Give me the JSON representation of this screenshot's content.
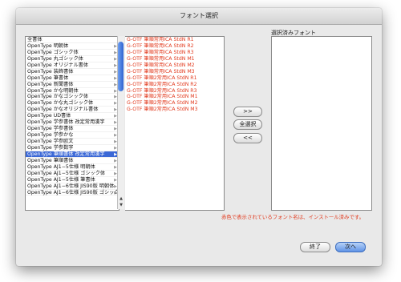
{
  "window": {
    "title": "フォント選択"
  },
  "font_categories": [
    {
      "label": "全書体",
      "selected": false
    },
    {
      "label": "OpenType 明朝体",
      "selected": false
    },
    {
      "label": "OpenType ゴシック体",
      "selected": false
    },
    {
      "label": "OpenType 丸ゴシック体",
      "selected": false
    },
    {
      "label": "OpenType オリジナル書体",
      "selected": false
    },
    {
      "label": "OpenType 装飾書体",
      "selected": false
    },
    {
      "label": "OpenType 筆書体",
      "selected": false
    },
    {
      "label": "OpenType 新聞書体",
      "selected": false
    },
    {
      "label": "OpenType かな明朝体",
      "selected": false
    },
    {
      "label": "OpenType かなゴシック体",
      "selected": false
    },
    {
      "label": "OpenType かな丸ゴシック体",
      "selected": false
    },
    {
      "label": "OpenType かなオリジナル書体",
      "selected": false
    },
    {
      "label": "OpenType UD書体",
      "selected": false
    },
    {
      "label": "OpenType 学参書体 改定常用漢字",
      "selected": false
    },
    {
      "label": "OpenType 学参書体",
      "selected": false
    },
    {
      "label": "OpenType 学参かな",
      "selected": false
    },
    {
      "label": "OpenType 学参欧文",
      "selected": false
    },
    {
      "label": "OpenType 学参数字",
      "selected": false
    },
    {
      "label": "OpenType 筆順書体 改定常用漢字",
      "selected": true
    },
    {
      "label": "OpenType 筆順書体",
      "selected": false
    },
    {
      "label": "OpenType AJ1−5仕様 明朝体",
      "selected": false
    },
    {
      "label": "OpenType AJ1−5仕様 ゴシック体",
      "selected": false
    },
    {
      "label": "OpenType AJ1−5仕様 筆書体",
      "selected": false
    },
    {
      "label": "OpenType AJ1−6仕様 JIS90版 明朝体",
      "selected": false
    },
    {
      "label": "OpenType AJ1−6仕様 JIS90版 ゴシック",
      "selected": false
    }
  ],
  "font_list": [
    "G-OTF 筆順常用ICA StdN R1",
    "G-OTF 筆順常用ICA StdN R2",
    "G-OTF 筆順常用ICA StdN R3",
    "G-OTF 筆順常用ICA StdN M1",
    "G-OTF 筆順常用ICA StdN M2",
    "G-OTF 筆順常用ICA StdN M3",
    "G-OTF 筆順2常用ICA StdN R1",
    "G-OTF 筆順2常用ICA StdN R2",
    "G-OTF 筆順2常用ICA StdN R3",
    "G-OTF 筆順2常用ICA StdN M1",
    "G-OTF 筆順2常用ICA StdN M2",
    "G-OTF 筆順2常用ICA StdN M3"
  ],
  "buttons": {
    "add": ">>",
    "select_all": "全選択",
    "remove": "<<",
    "quit": "終了",
    "next": "次へ"
  },
  "selected_fonts": {
    "label": "選択済みフォント"
  },
  "note": "赤色で表示されているフォント名は、インストール済みです。",
  "colors": {
    "accent": "#3b68d6",
    "installed_text": "#e23a1e"
  }
}
